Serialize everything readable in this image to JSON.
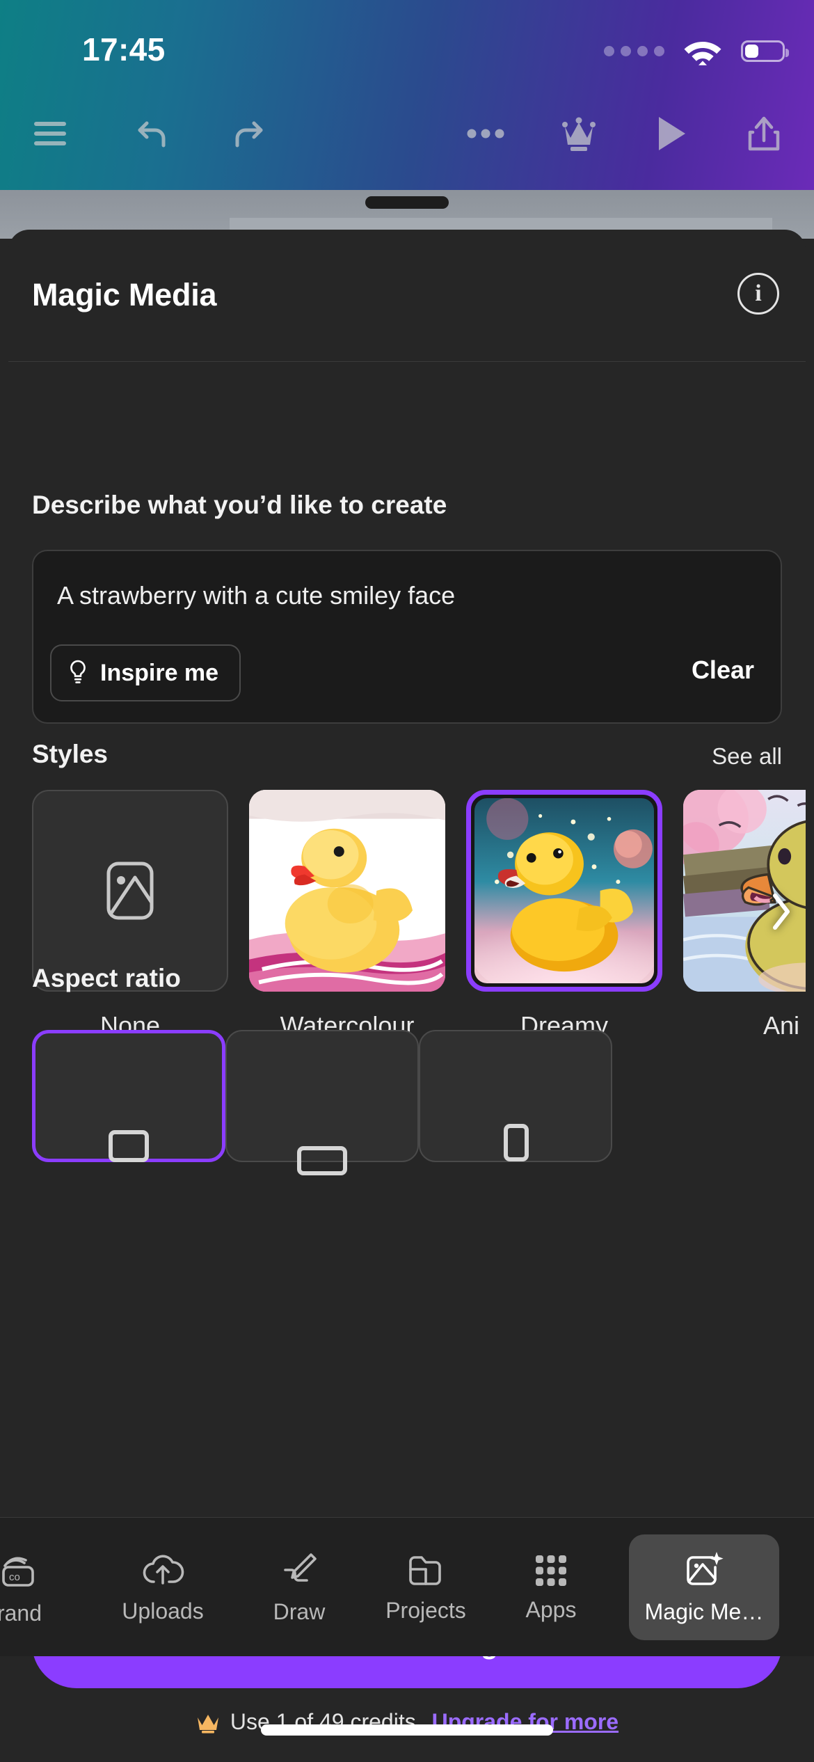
{
  "status_bar": {
    "time": "17:45",
    "signal_icon": "signal-dots-icon",
    "wifi_icon": "wifi-icon",
    "battery_icon": "battery-icon"
  },
  "editor_toolbar": {
    "menu_icon": "hamburger-menu-icon",
    "undo_icon": "undo-icon",
    "redo_icon": "redo-icon",
    "more_icon": "more-horizontal-icon",
    "crown_icon": "crown-icon",
    "play_icon": "play-icon",
    "share_icon": "share-upload-icon"
  },
  "sheet": {
    "grabber": "drag-handle",
    "title": "Magic Media",
    "info_icon": "info-icon",
    "info_label": "i"
  },
  "prompt": {
    "section_label": "Describe what you’d like to create",
    "value": "A strawberry with a cute smiley face",
    "placeholder": "Describe what you’d like to create",
    "inspire_label": "Inspire me",
    "inspire_icon": "lightbulb-icon",
    "clear_label": "Clear"
  },
  "styles": {
    "section_label": "Styles",
    "see_all_label": "See all",
    "next_icon": "chevron-right-icon",
    "items": [
      {
        "label": "None",
        "icon": "image-placeholder-icon",
        "selected": false,
        "kind": "none"
      },
      {
        "label": "Watercolour",
        "icon": "duck-watercolour-thumb",
        "selected": false,
        "kind": "image"
      },
      {
        "label": "Dreamy",
        "icon": "duck-dreamy-thumb",
        "selected": true,
        "kind": "image"
      },
      {
        "label": "Ani",
        "icon": "duck-anime-thumb",
        "selected": false,
        "kind": "image"
      }
    ]
  },
  "aspect_ratio": {
    "section_label": "Aspect ratio",
    "items": [
      {
        "icon": "aspect-landscape-icon",
        "selected": true
      },
      {
        "icon": "aspect-wide-icon",
        "selected": false
      },
      {
        "icon": "aspect-portrait-icon",
        "selected": false
      }
    ]
  },
  "footer": {
    "generate_label": "Generate image",
    "credits_icon": "crown-icon",
    "credits_text": "Use 1 of 49 credits.",
    "upgrade_label": "Upgrade for more",
    "accent_color": "#8b3dff",
    "credits_used": 1,
    "credits_total": 49
  },
  "bottom_nav": {
    "items": [
      {
        "label": "rand",
        "icon": "brand-icon",
        "active": false
      },
      {
        "label": "Uploads",
        "icon": "cloud-upload-icon",
        "active": false
      },
      {
        "label": "Draw",
        "icon": "pen-draw-icon",
        "active": false
      },
      {
        "label": "Projects",
        "icon": "folder-icon",
        "active": false
      },
      {
        "label": "Apps",
        "icon": "grid-apps-icon",
        "active": false
      },
      {
        "label": "Magic Me…",
        "icon": "magic-media-icon",
        "active": true
      }
    ]
  },
  "home_indicator": "home-indicator-bar"
}
